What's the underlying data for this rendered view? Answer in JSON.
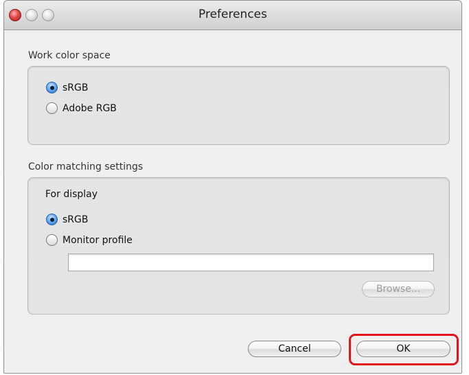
{
  "window": {
    "title": "Preferences"
  },
  "work_color_space": {
    "title": "Work color space",
    "options": [
      {
        "label": "sRGB",
        "checked": true
      },
      {
        "label": "Adobe RGB",
        "checked": false
      }
    ]
  },
  "color_matching": {
    "title": "Color matching settings",
    "for_display_label": "For display",
    "options": [
      {
        "label": "sRGB",
        "checked": true
      },
      {
        "label": "Monitor profile",
        "checked": false
      }
    ],
    "profile_value": "",
    "browse_label": "Browse..."
  },
  "buttons": {
    "cancel": "Cancel",
    "ok": "OK"
  },
  "colors": {
    "highlight": "#e3131b",
    "radio_selected": "#2466c6"
  }
}
